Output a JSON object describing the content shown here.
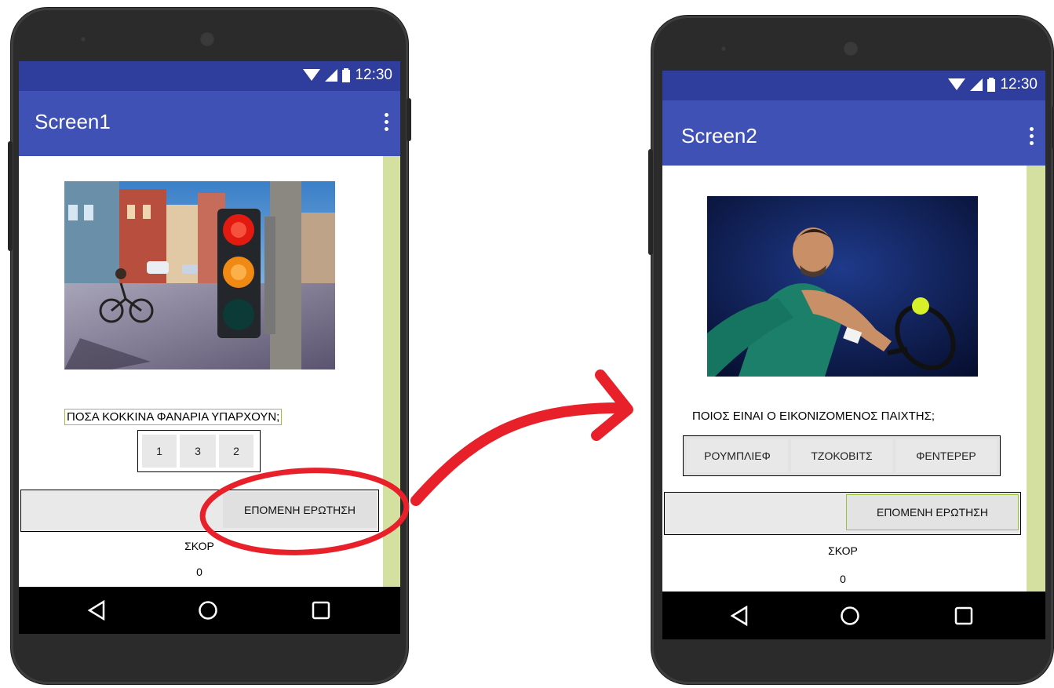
{
  "status_time": "12:30",
  "screen1": {
    "title": "Screen1",
    "question": "ΠΟΣΑ ΚΟΚΚΙΝΑ ΦΑΝΑΡΙΑ ΥΠΑΡΧΟΥΝ;",
    "answers": [
      "1",
      "3",
      "2"
    ],
    "next_button": "ΕΠΟΜΕΝΗ ΕΡΩΤΗΣΗ",
    "score_label": "ΣΚΟΡ",
    "score_value": "0"
  },
  "screen2": {
    "title": "Screen2",
    "question": "ΠΟΙΟΣ ΕΙΝΑΙ Ο ΕΙΚΟΝΙΖΟΜΕΝΟΣ ΠΑΙΧΤΗΣ;",
    "answers": [
      "ΡΟΥΜΠΛΙΕΦ",
      "ΤΖΟΚΟΒΙΤΣ",
      "ΦΕΝΤΕΡΕΡ"
    ],
    "next_button": "ΕΠΟΜΕΝΗ ΕΡΩΤΗΣΗ",
    "score_label": "ΣΚΟΡ",
    "score_value": "0"
  },
  "colors": {
    "status_bar": "#2f3d9c",
    "app_bar": "#3f51b5",
    "annotation_red": "#e8202a",
    "scroll_strip": "#d3e0a0"
  },
  "icons": [
    "wifi-icon",
    "signal-icon",
    "battery-icon",
    "overflow-menu-icon",
    "nav-back-icon",
    "nav-home-icon",
    "nav-recents-icon"
  ]
}
